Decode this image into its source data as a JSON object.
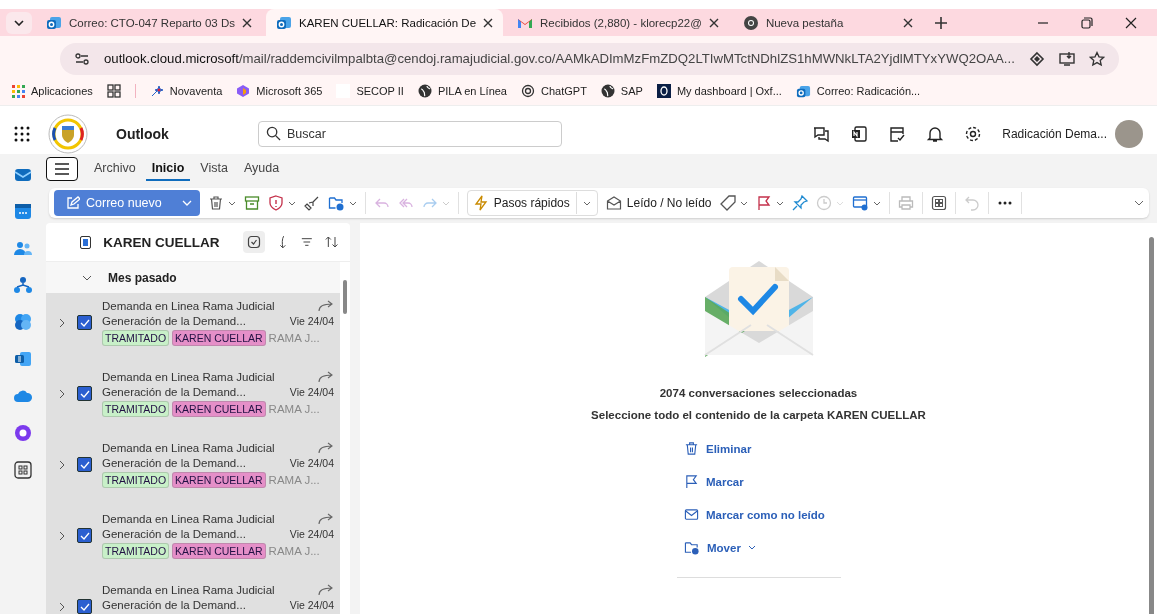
{
  "browser": {
    "tabs": [
      {
        "title": "Correo: CTO-047 Reparto 03 Ds",
        "selected": false
      },
      {
        "title": "KAREN CUELLAR: Radicación De",
        "selected": true
      },
      {
        "title": "Recibidos (2,880) - klorecp22@",
        "selected": false
      },
      {
        "title": "Nueva pestaña",
        "selected": false
      }
    ],
    "url_host": "outlook.cloud.microsoft",
    "url_path": "/mail/raddemcivilmpalbta@cendoj.ramajudicial.gov.co/AAMkADImMzFmZDQ2LTIwMTctNDhlZS1hMWNkLTA2YjdlMTYxYWQ2OAA...",
    "bookmarks": [
      "Aplicaciones",
      "Novaventa",
      "Microsoft 365",
      "SECOP II",
      "PILA en Línea",
      "ChatGPT",
      "SAP",
      "My dashboard | Oxf...",
      "Correo: Radicación..."
    ]
  },
  "app": {
    "name": "Outlook",
    "search": {
      "placeholder": "Buscar"
    },
    "account": "Radicación Dema..."
  },
  "ribbon": {
    "tabs": [
      {
        "label": "Archivo",
        "selected": false
      },
      {
        "label": "Inicio",
        "selected": true
      },
      {
        "label": "Vista",
        "selected": false
      },
      {
        "label": "Ayuda",
        "selected": false
      }
    ],
    "new_mail": "Correo nuevo",
    "quick_steps": "Pasos rápidos",
    "read_unread": "Leído / No leído"
  },
  "folder": {
    "name": "KAREN CUELLAR",
    "all_selected": true,
    "group": "Mes pasado",
    "expanded": true,
    "messages": [
      {
        "sender": "Demanda en Linea Rama Judicial",
        "subject": "Generación de la Demand...",
        "date": "Vie 24/04",
        "checked": true,
        "tags": [
          {
            "label": "TRAMITADO",
            "color": "#c8f0c8"
          },
          {
            "label": "KAREN CUELLAR",
            "color": "#e58fc8"
          }
        ],
        "preview": "RAMA J..."
      },
      {
        "sender": "Demanda en Linea Rama Judicial",
        "subject": "Generación de la Demand...",
        "date": "Vie 24/04",
        "checked": true,
        "tags": [
          {
            "label": "TRAMITADO",
            "color": "#c8f0c8"
          },
          {
            "label": "KAREN CUELLAR",
            "color": "#e58fc8"
          }
        ],
        "preview": "RAMA J..."
      },
      {
        "sender": "Demanda en Linea Rama Judicial",
        "subject": "Generación de la Demand...",
        "date": "Vie 24/04",
        "checked": true,
        "tags": [
          {
            "label": "TRAMITADO",
            "color": "#c8f0c8"
          },
          {
            "label": "KAREN CUELLAR",
            "color": "#e58fc8"
          }
        ],
        "preview": "RAMA J..."
      },
      {
        "sender": "Demanda en Linea Rama Judicial",
        "subject": "Generación de la Demand...",
        "date": "Vie 24/04",
        "checked": true,
        "tags": [
          {
            "label": "TRAMITADO",
            "color": "#c8f0c8"
          },
          {
            "label": "KAREN CUELLAR",
            "color": "#e58fc8"
          }
        ],
        "preview": "RAMA J..."
      },
      {
        "sender": "Demanda en Linea Rama Judicial",
        "subject": "Generación de la Demand...",
        "date": "Vie 24/04",
        "checked": true
      }
    ]
  },
  "selection": {
    "count_text": "2074 conversaciones seleccionadas",
    "select_all": "Seleccione todo el contenido de la carpeta KAREN CUELLAR",
    "actions": [
      "Eliminar",
      "Marcar",
      "Marcar como no leído",
      "Mover"
    ]
  }
}
